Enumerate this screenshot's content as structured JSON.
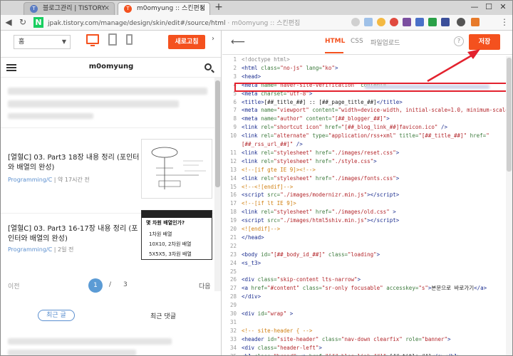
{
  "browser": {
    "tabs": [
      {
        "label": "블로그관리 | TISTORY",
        "favicon": "T",
        "color": "#5a7bc2"
      },
      {
        "label": "m0omyung :: 스킨편집",
        "favicon": "T",
        "color": "#f4511e"
      }
    ],
    "new_tab": "+",
    "window_controls": [
      "—",
      "☐",
      "✕"
    ],
    "url_main": "jpak.tistory.com/manage/design/skin/edit#/source/html",
    "url_title": "m0omyung :: 스킨편집",
    "n_logo": "N"
  },
  "preview": {
    "page_select": "홈",
    "refresh_label": "새로고침",
    "blog_name": "m0omyung",
    "posts": [
      {
        "title": "[열혈C] 03. Part3 18장 내용 정리 (포인터와 배열의 완성)",
        "category": "Programming/C",
        "time": "약 17시간 전"
      },
      {
        "title": "[열혈C] 03. Part3 16-17장 내용 정리 (포인터와 배열의 완성)",
        "category": "Programming/C",
        "time": "2일 전"
      }
    ],
    "thumb2": {
      "title": "몇 차원 배열인가?",
      "rows": [
        "1차원 배열",
        "10X10, 2차원 배열",
        "5X5X5, 3차원 배열"
      ]
    },
    "pager": {
      "prev": "이전",
      "current": "1",
      "sep": "/",
      "total": "3",
      "next": "다음"
    },
    "bottom_tabs": {
      "recent_posts": "최근 글",
      "recent_comments": "최근 댓글"
    }
  },
  "editor": {
    "tabs": {
      "html": "HTML",
      "css": "CSS",
      "upload": "파일업로드"
    },
    "help": "?",
    "save_label": "저장",
    "highlight_color": "#e3222e",
    "accent": "#f4511e",
    "lines": [
      {
        "n": "1",
        "html": "<span class='g'>&lt;!doctype html&gt;</span>"
      },
      {
        "n": "2",
        "html": "<span class='t'>&lt;html</span> <span class='a'>class=</span><span class='s'>\"no-js\"</span> <span class='a'>lang=</span><span class='s'>\"ko\"</span><span class='t'>&gt;</span>"
      },
      {
        "n": "3",
        "html": "<span class='t'>&lt;head&gt;</span>"
      },
      {
        "n": "4",
        "html": "<span class='t'>  &lt;meta</span> <span class='a'>name=</span><span class='s'>\"naver-site-verification\"</span> <span class='a'>content=</span><span class='s'>\"</span>"
      },
      {
        "n": "5",
        "html": "<span class='t'>  &lt;meta</span> <span class='a'>charset=</span><span class='s'>\"utf-8\"</span><span class='t'>&gt;</span>"
      },
      {
        "n": "6",
        "html": "<span class='t'>  &lt;title&gt;</span><span class='p'>[##_title_##] :: [##_page_title_##]</span><span class='t'>&lt;/title&gt;</span>"
      },
      {
        "n": "7",
        "html": "<span class='t'>  &lt;meta</span> <span class='a'>name=</span><span class='s'>\"viewport\"</span> <span class='a'>content=</span><span class='s'>\"width=device-width, initial-scale=1.0, minimum-scale=1.0\"</span><span class='t'>&gt;</span>"
      },
      {
        "n": "8",
        "html": "<span class='t'>  &lt;meta</span> <span class='a'>name=</span><span class='s'>\"author\"</span> <span class='a'>content=</span><span class='s'>\"[##_blogger_##]\"</span><span class='t'>&gt;</span>"
      },
      {
        "n": "9",
        "html": "<span class='t'>  &lt;link</span> <span class='a'>rel=</span><span class='s'>\"shortcut icon\"</span> <span class='a'>href=</span><span class='s'>\"[##_blog_link_##]favicon.ico\"</span> <span class='t'>/&gt;</span>"
      },
      {
        "n": "10",
        "html": "<span class='t'>  &lt;link</span> <span class='a'>rel=</span><span class='s'>\"alternate\"</span> <span class='a'>type=</span><span class='s'>\"application/rss+xml\"</span> <span class='a'>title=</span><span class='s'>\"[##_title_##]\"</span> <span class='a'>href=</span><span class='s'>\"</span>"
      },
      {
        "n": "",
        "html": "<span class='s'>[##_rss_url_##]\"</span> <span class='t'>/&gt;</span>"
      },
      {
        "n": "11",
        "html": "<span class='t'>  &lt;link</span> <span class='a'>rel=</span><span class='s'>\"stylesheet\"</span> <span class='a'>href=</span><span class='s'>\"./images/reset.css\"</span><span class='t'>&gt;</span>"
      },
      {
        "n": "12",
        "html": "<span class='t'>  &lt;link</span> <span class='a'>rel=</span><span class='s'>\"stylesheet\"</span> <span class='a'>href=</span><span class='s'>\"./style.css\"</span><span class='t'>&gt;</span>"
      },
      {
        "n": "13",
        "html": "<span class='c'>  &lt;!--[if gte IE 9]&gt;&lt;!--&gt;</span>"
      },
      {
        "n": "14",
        "html": "<span class='t'>  &lt;link</span> <span class='a'>rel=</span><span class='s'>\"stylesheet\"</span> <span class='a'>href=</span><span class='s'>\"./images/fonts.css\"</span><span class='t'>&gt;</span>"
      },
      {
        "n": "15",
        "html": "<span class='c'>  &lt;!--&lt;![endif]--&gt;</span>"
      },
      {
        "n": "16",
        "html": "<span class='t'>  &lt;script</span> <span class='a'>src=</span><span class='s'>\"./images/modernizr.min.js\"</span><span class='t'>&gt;&lt;/script&gt;</span>"
      },
      {
        "n": "17",
        "html": "<span class='c'>  &lt;!--[if lt IE 9]&gt;</span>"
      },
      {
        "n": "18",
        "html": "<span class='t'>    &lt;link</span> <span class='a'>rel=</span><span class='s'>\"stylesheet\"</span> <span class='a'>href=</span><span class='s'>\"./images/old.css\"</span> <span class='t'>&gt;</span>"
      },
      {
        "n": "19",
        "html": "<span class='t'>    &lt;script</span> <span class='a'>src=</span><span class='s'>\"./images/html5shiv.min.js\"</span><span class='t'>&gt;&lt;/script&gt;</span>"
      },
      {
        "n": "20",
        "html": "<span class='c'>  &lt;![endif]--&gt;</span>"
      },
      {
        "n": "21",
        "html": "<span class='t'>&lt;/head&gt;</span>"
      },
      {
        "n": "22",
        "html": ""
      },
      {
        "n": "23",
        "html": "<span class='t'>&lt;body</span> <span class='a'>id=</span><span class='s'>\"[##_body_id_##]\"</span> <span class='a'>class=</span><span class='s'>\"loading\"</span><span class='t'>&gt;</span>"
      },
      {
        "n": "24",
        "html": "<span class='t'>&lt;s_t3&gt;</span>"
      },
      {
        "n": "25",
        "html": ""
      },
      {
        "n": "26",
        "html": "<span class='t'>&lt;div</span> <span class='a'>class=</span><span class='s'>\"skip-content lts-narrow\"</span><span class='t'>&gt;</span>"
      },
      {
        "n": "27",
        "html": "<span class='t'>  &lt;a</span> <span class='a'>href=</span><span class='s'>\"#content\"</span> <span class='a'>class=</span><span class='s'>\"sr-only focusable\"</span> <span class='a'>accesskey=</span><span class='s'>\"s\"</span><span class='t'>&gt;</span><span class='p'>본문으로 바로가기</span><span class='t'>&lt;/a&gt;</span>"
      },
      {
        "n": "28",
        "html": "<span class='t'>&lt;/div&gt;</span>"
      },
      {
        "n": "29",
        "html": ""
      },
      {
        "n": "30",
        "html": "<span class='t'>&lt;div</span> <span class='a'>id=</span><span class='s'>\"wrap\"</span> <span class='t'>&gt;</span>"
      },
      {
        "n": "31",
        "html": ""
      },
      {
        "n": "32",
        "html": "<span class='c'>&lt;!-- site-header  { --&gt;</span>"
      },
      {
        "n": "33",
        "html": "<span class='t'>&lt;header</span> <span class='a'>id=</span><span class='s'>\"site-header\"</span> <span class='a'>class=</span><span class='s'>\"nav-down clearfix\"</span> <span class='a'>role=</span><span class='s'>\"banner\"</span><span class='t'>&gt;</span>"
      },
      {
        "n": "34",
        "html": "<span class='t'>  &lt;div</span> <span class='a'>class=</span><span class='s'>\"header-left\"</span><span class='t'>&gt;</span>"
      },
      {
        "n": "35",
        "html": "<span class='t'>    &lt;h1</span> <span class='a'>class=</span><span class='s'>\"brand\"</span><span class='t'>&gt;&lt;a</span> <span class='a'>href=</span><span class='s'>\"[##_blog_link_##]\"</span><span class='t'>&gt;</span><span class='p'>[##_title_##]</span><span class='t'>&lt;/a&gt;&lt;/h1&gt;</span>"
      }
    ]
  }
}
